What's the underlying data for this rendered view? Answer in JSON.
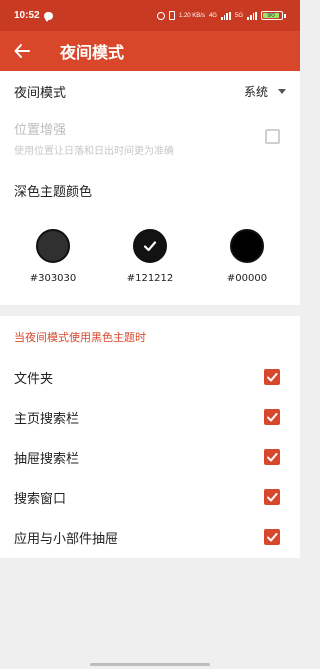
{
  "status_bar": {
    "time": "10:52",
    "net_label": "1.20 KB/s",
    "net_type_1": "4G",
    "net_type_2": "5G",
    "battery_level": "90"
  },
  "header": {
    "title": "夜间模式"
  },
  "night_mode": {
    "label": "夜间模式",
    "value": "系统"
  },
  "location": {
    "title": "位置增强",
    "subtitle": "使用位置让日落和日出时间更为准确",
    "checked": false,
    "enabled": false
  },
  "dark_theme": {
    "title": "深色主题颜色",
    "swatches": [
      {
        "code": "#303030",
        "color": "#303030",
        "selected": false
      },
      {
        "code": "#121212",
        "color": "#121212",
        "selected": true
      },
      {
        "code": "#00000",
        "color": "#000000",
        "selected": false
      }
    ]
  },
  "black_theme_section": {
    "title": "当夜间模式使用黑色主题时",
    "items": [
      {
        "label": "文件夹",
        "checked": true
      },
      {
        "label": "主页搜索栏",
        "checked": true
      },
      {
        "label": "抽屉搜索栏",
        "checked": true
      },
      {
        "label": "搜索窗口",
        "checked": true
      },
      {
        "label": "应用与小部件抽屉",
        "checked": true
      }
    ]
  },
  "colors": {
    "status_bar": "#c93a22",
    "app_bar": "#d9472b",
    "accent": "#d9472b",
    "background": "#efefef"
  }
}
